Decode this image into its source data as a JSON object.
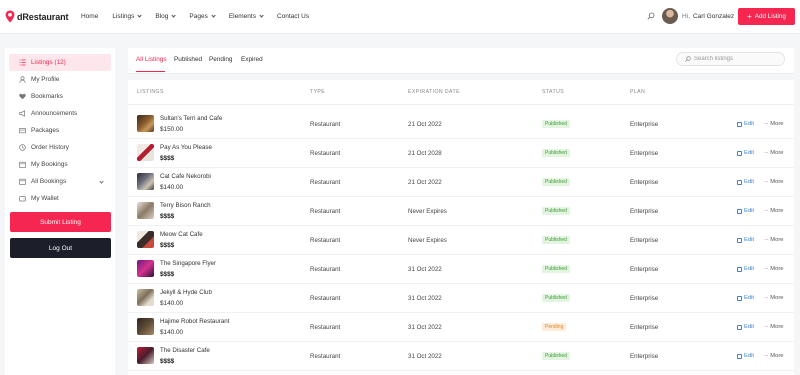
{
  "header": {
    "brand": "dRestaurant",
    "nav": [
      {
        "label": "Home",
        "dropdown": false
      },
      {
        "label": "Listings",
        "dropdown": true
      },
      {
        "label": "Blog",
        "dropdown": true
      },
      {
        "label": "Pages",
        "dropdown": true
      },
      {
        "label": "Elements",
        "dropdown": true
      },
      {
        "label": "Contact Us",
        "dropdown": false
      }
    ],
    "greeting": "Hi,",
    "user_name": "Carl Gonzalez",
    "add_listing": "Add Listing",
    "accent": "#f5264f"
  },
  "sidebar": {
    "items": [
      {
        "label": "Listings (12)",
        "icon": "list-icon",
        "active": true
      },
      {
        "label": "My Profile",
        "icon": "user-icon"
      },
      {
        "label": "Bookmarks",
        "icon": "heart-icon"
      },
      {
        "label": "Announcements",
        "icon": "megaphone-icon"
      },
      {
        "label": "Packages",
        "icon": "package-icon"
      },
      {
        "label": "Order History",
        "icon": "clock-icon"
      },
      {
        "label": "My Bookings",
        "icon": "calendar-icon"
      },
      {
        "label": "All Bookings",
        "icon": "calendar-icon",
        "dropdown": true
      },
      {
        "label": "My Wallet",
        "icon": "wallet-icon"
      }
    ],
    "submit_listing": "Submit Listing",
    "log_out": "Log Out"
  },
  "tabs": [
    "All Listings",
    "Published",
    "Pending",
    "Expired"
  ],
  "search": {
    "placeholder": "Search listings"
  },
  "table": {
    "columns": [
      "LISTINGS",
      "TYPE",
      "EXPIRATION DATE",
      "STATUS",
      "PLAN"
    ],
    "edit_label": "Edit",
    "more_label": "More",
    "rows": [
      {
        "title": "Sultan's Terri and Cafe",
        "price": "$150.00",
        "type": "Restaurant",
        "expiration": "21 Oct 2022",
        "status": "Published",
        "plan": "Enterprise"
      },
      {
        "title": "Pay As You Please",
        "price": "$$$$",
        "type": "Restaurant",
        "expiration": "21 Oct 2028",
        "status": "Published",
        "plan": "Enterprise"
      },
      {
        "title": "Cat Cafe Nekorobi",
        "price": "$140.00",
        "type": "Restaurant",
        "expiration": "21 Oct 2022",
        "status": "Published",
        "plan": "Enterprise"
      },
      {
        "title": "Terry Bison Ranch",
        "price": "$$$$",
        "type": "Restaurant",
        "expiration": "Never Expires",
        "status": "Published",
        "plan": "Enterprise"
      },
      {
        "title": "Meow Cat Cafe",
        "price": "$$$$",
        "type": "Restaurant",
        "expiration": "Never Expires",
        "status": "Published",
        "plan": "Enterprise"
      },
      {
        "title": "The Singapore Flyer",
        "price": "$$$$",
        "type": "Restaurant",
        "expiration": "31 Oct 2022",
        "status": "Published",
        "plan": "Enterprise"
      },
      {
        "title": "Jekyll & Hyde Club",
        "price": "$140.00",
        "type": "Restaurant",
        "expiration": "31 Oct 2022",
        "status": "Published",
        "plan": "Enterprise"
      },
      {
        "title": "Hajime Robot Restaurant",
        "price": "$140.00",
        "type": "Restaurant",
        "expiration": "31 Oct 2022",
        "status": "Pending",
        "plan": "Enterprise"
      },
      {
        "title": "The Disaster Cafe",
        "price": "$$$$",
        "type": "Restaurant",
        "expiration": "31 Oct 2022",
        "status": "Published",
        "plan": "Enterprise"
      }
    ]
  }
}
